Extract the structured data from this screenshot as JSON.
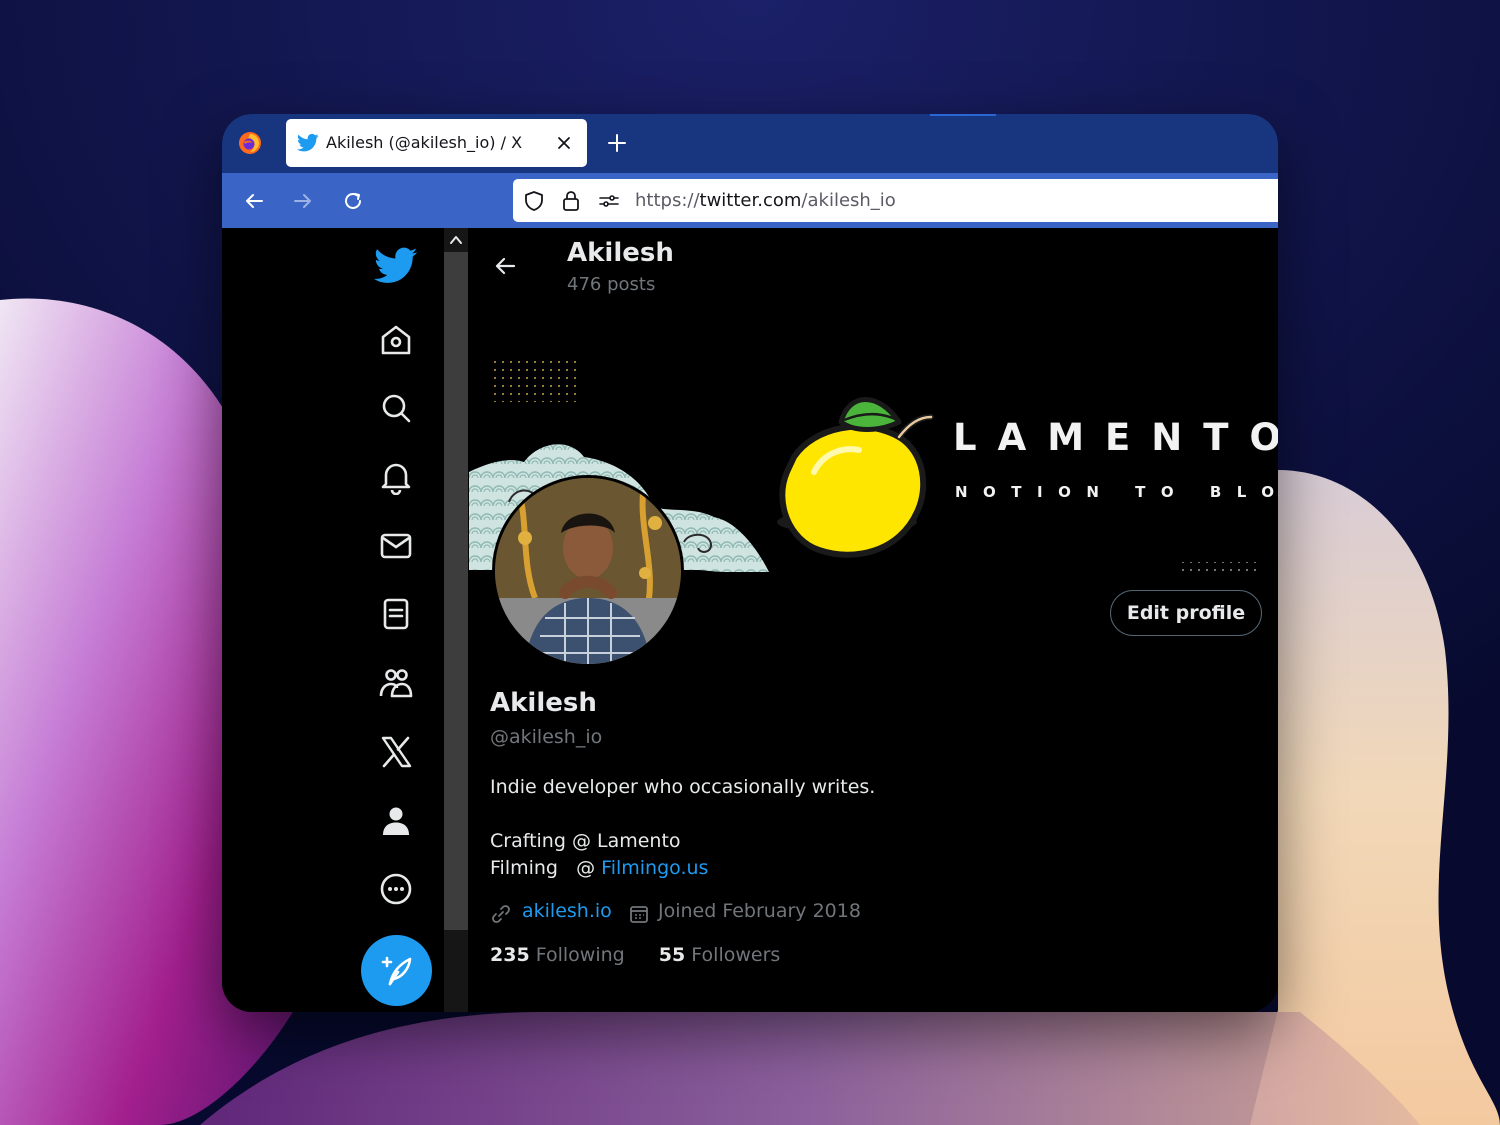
{
  "browser": {
    "tab_title": "Akilesh (@akilesh_io) / X",
    "url_prefix": "https://",
    "url_host": "twitter.com",
    "url_path": "/akilesh_io"
  },
  "profile": {
    "header_name": "Akilesh",
    "header_posts": "476 posts",
    "banner_brand": "LAMENTO",
    "banner_tagline": "NOTION TO BLOG",
    "edit_label": "Edit profile",
    "name": "Akilesh",
    "handle": "@akilesh_io",
    "bio_line1": "Indie developer who occasionally writes.",
    "bio_line2": "Crafting @ Lamento",
    "bio_line3_prefix": "Filming   @ ",
    "bio_line3_link": "Filmingo.us",
    "website": "akilesh.io",
    "joined": "Joined February 2018",
    "following_count": "235",
    "following_label": "Following",
    "followers_count": "55",
    "followers_label": "Followers"
  },
  "colors": {
    "accent": "#1d9bf0",
    "tabbar": "#183580",
    "navbar": "#3a64c6"
  },
  "sidebar_icons": [
    "twitter-logo-icon",
    "home-icon",
    "search-icon",
    "bell-icon",
    "mail-icon",
    "lists-icon",
    "communities-icon",
    "x-logo-icon",
    "profile-icon",
    "more-icon",
    "compose-icon"
  ]
}
